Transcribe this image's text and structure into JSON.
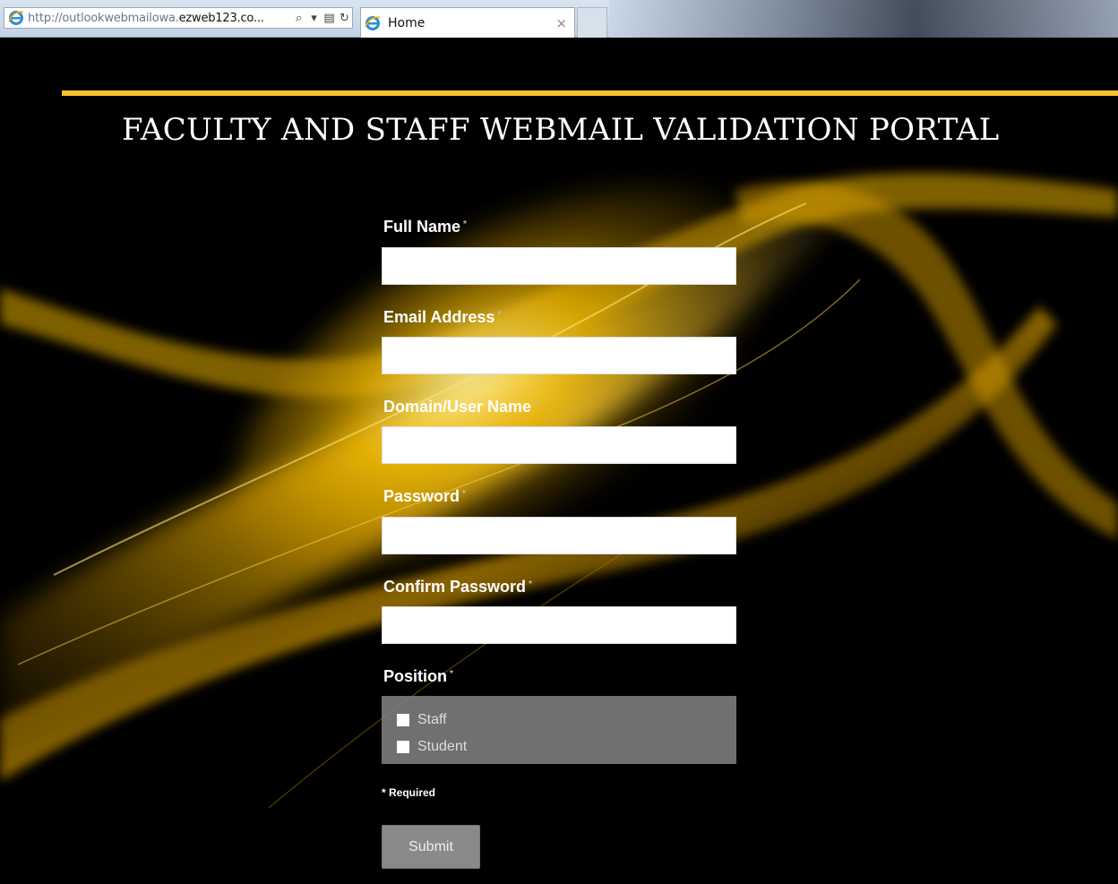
{
  "browser": {
    "url_prefix": "http://outlookwebmailowa.",
    "url_domain": "ezweb123.co...",
    "search_glyph": "⌕",
    "dropdown_glyph": "▾",
    "compat_glyph": "▤",
    "refresh_glyph": "↻",
    "tab_title": "Home",
    "tab_close_glyph": "×"
  },
  "page": {
    "title": "FACULTY AND STAFF WEBMAIL VALIDATION PORTAL",
    "accent_color": "#f5c12e"
  },
  "form": {
    "required_marker": "*",
    "fields": [
      {
        "label": "Full Name",
        "value": ""
      },
      {
        "label": "Email Address",
        "value": ""
      },
      {
        "label": "Domain/User Name",
        "value": ""
      },
      {
        "label": "Password",
        "value": ""
      },
      {
        "label": "Confirm Password",
        "value": ""
      }
    ],
    "position": {
      "label": "Position",
      "options": [
        {
          "label": "Staff",
          "checked": false
        },
        {
          "label": "Student",
          "checked": false
        }
      ]
    },
    "required_note": "* Required",
    "submit_label": "Submit"
  }
}
